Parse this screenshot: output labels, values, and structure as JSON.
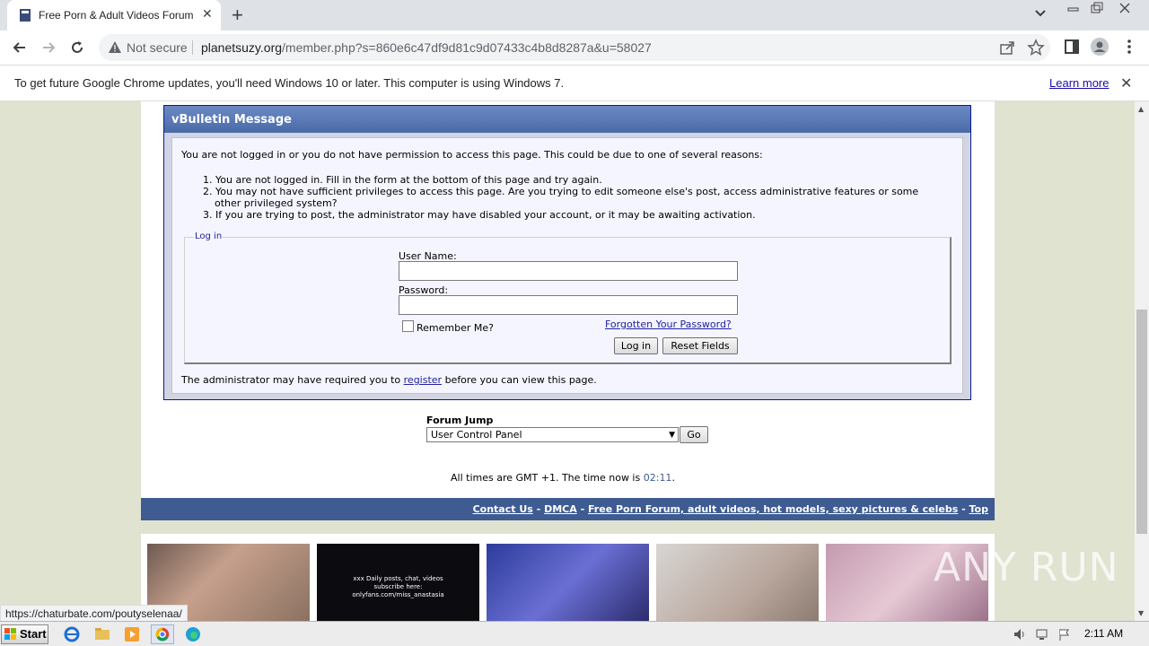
{
  "browser": {
    "tab_title": "Free Porn & Adult Videos Forum",
    "not_secure_label": "Not secure",
    "url_host": "planetsuzy.org",
    "url_path": "/member.php?s=860e6c47df9d81c9d07433c4b8d8287a&u=58027",
    "infobar_text": "To get future Google Chrome updates, you'll need Windows 10 or later. This computer is using Windows 7.",
    "infobar_link": "Learn more",
    "status_url": "https://chaturbate.com/poutyselenaa/"
  },
  "message": {
    "title": "vBulletin Message",
    "intro": "You are not logged in or you do not have permission to access this page. This could be due to one of several reasons:",
    "reasons": [
      "1. You are not logged in. Fill in the form at the bottom of this page and try again.",
      "2. You may not have sufficient privileges to access this page. Are you trying to edit someone else's post, access administrative features or some",
      "other privileged system?",
      "3. If you are trying to post, the administrator may have disabled your account, or it may be awaiting activation."
    ],
    "login_legend": "Log in",
    "username_label": "User Name:",
    "password_label": "Password:",
    "remember_label": "Remember Me?",
    "forgot_link": "Forgotten Your Password?",
    "login_button": "Log in",
    "reset_button": "Reset Fields",
    "admin_before": "The administrator may have required you to",
    "admin_link": "register",
    "admin_after": "before you can view this page."
  },
  "forum_jump": {
    "label": "Forum Jump",
    "selected": "User Control Panel",
    "go_button": "Go"
  },
  "times": {
    "prefix": "All times are GMT +1. The time now is",
    "time": "02:11",
    "suffix": "."
  },
  "footer": {
    "links": [
      "Contact Us",
      "DMCA",
      "Free Porn Forum, adult videos, hot models, sexy pictures & celebs",
      "Top"
    ],
    "separator": "-"
  },
  "thumbnail_text": [
    "xxx Daily posts, chat, videos",
    "subscribe here:",
    "onlyfans.com/miss_anastasia"
  ],
  "watermark": "ANY RUN",
  "taskbar": {
    "start_label": "Start",
    "clock": "2:11 AM"
  },
  "colors": {
    "page_bg": "#dfe3cf",
    "header_blue": "#3e5c92",
    "link_blue": "#22229c"
  }
}
